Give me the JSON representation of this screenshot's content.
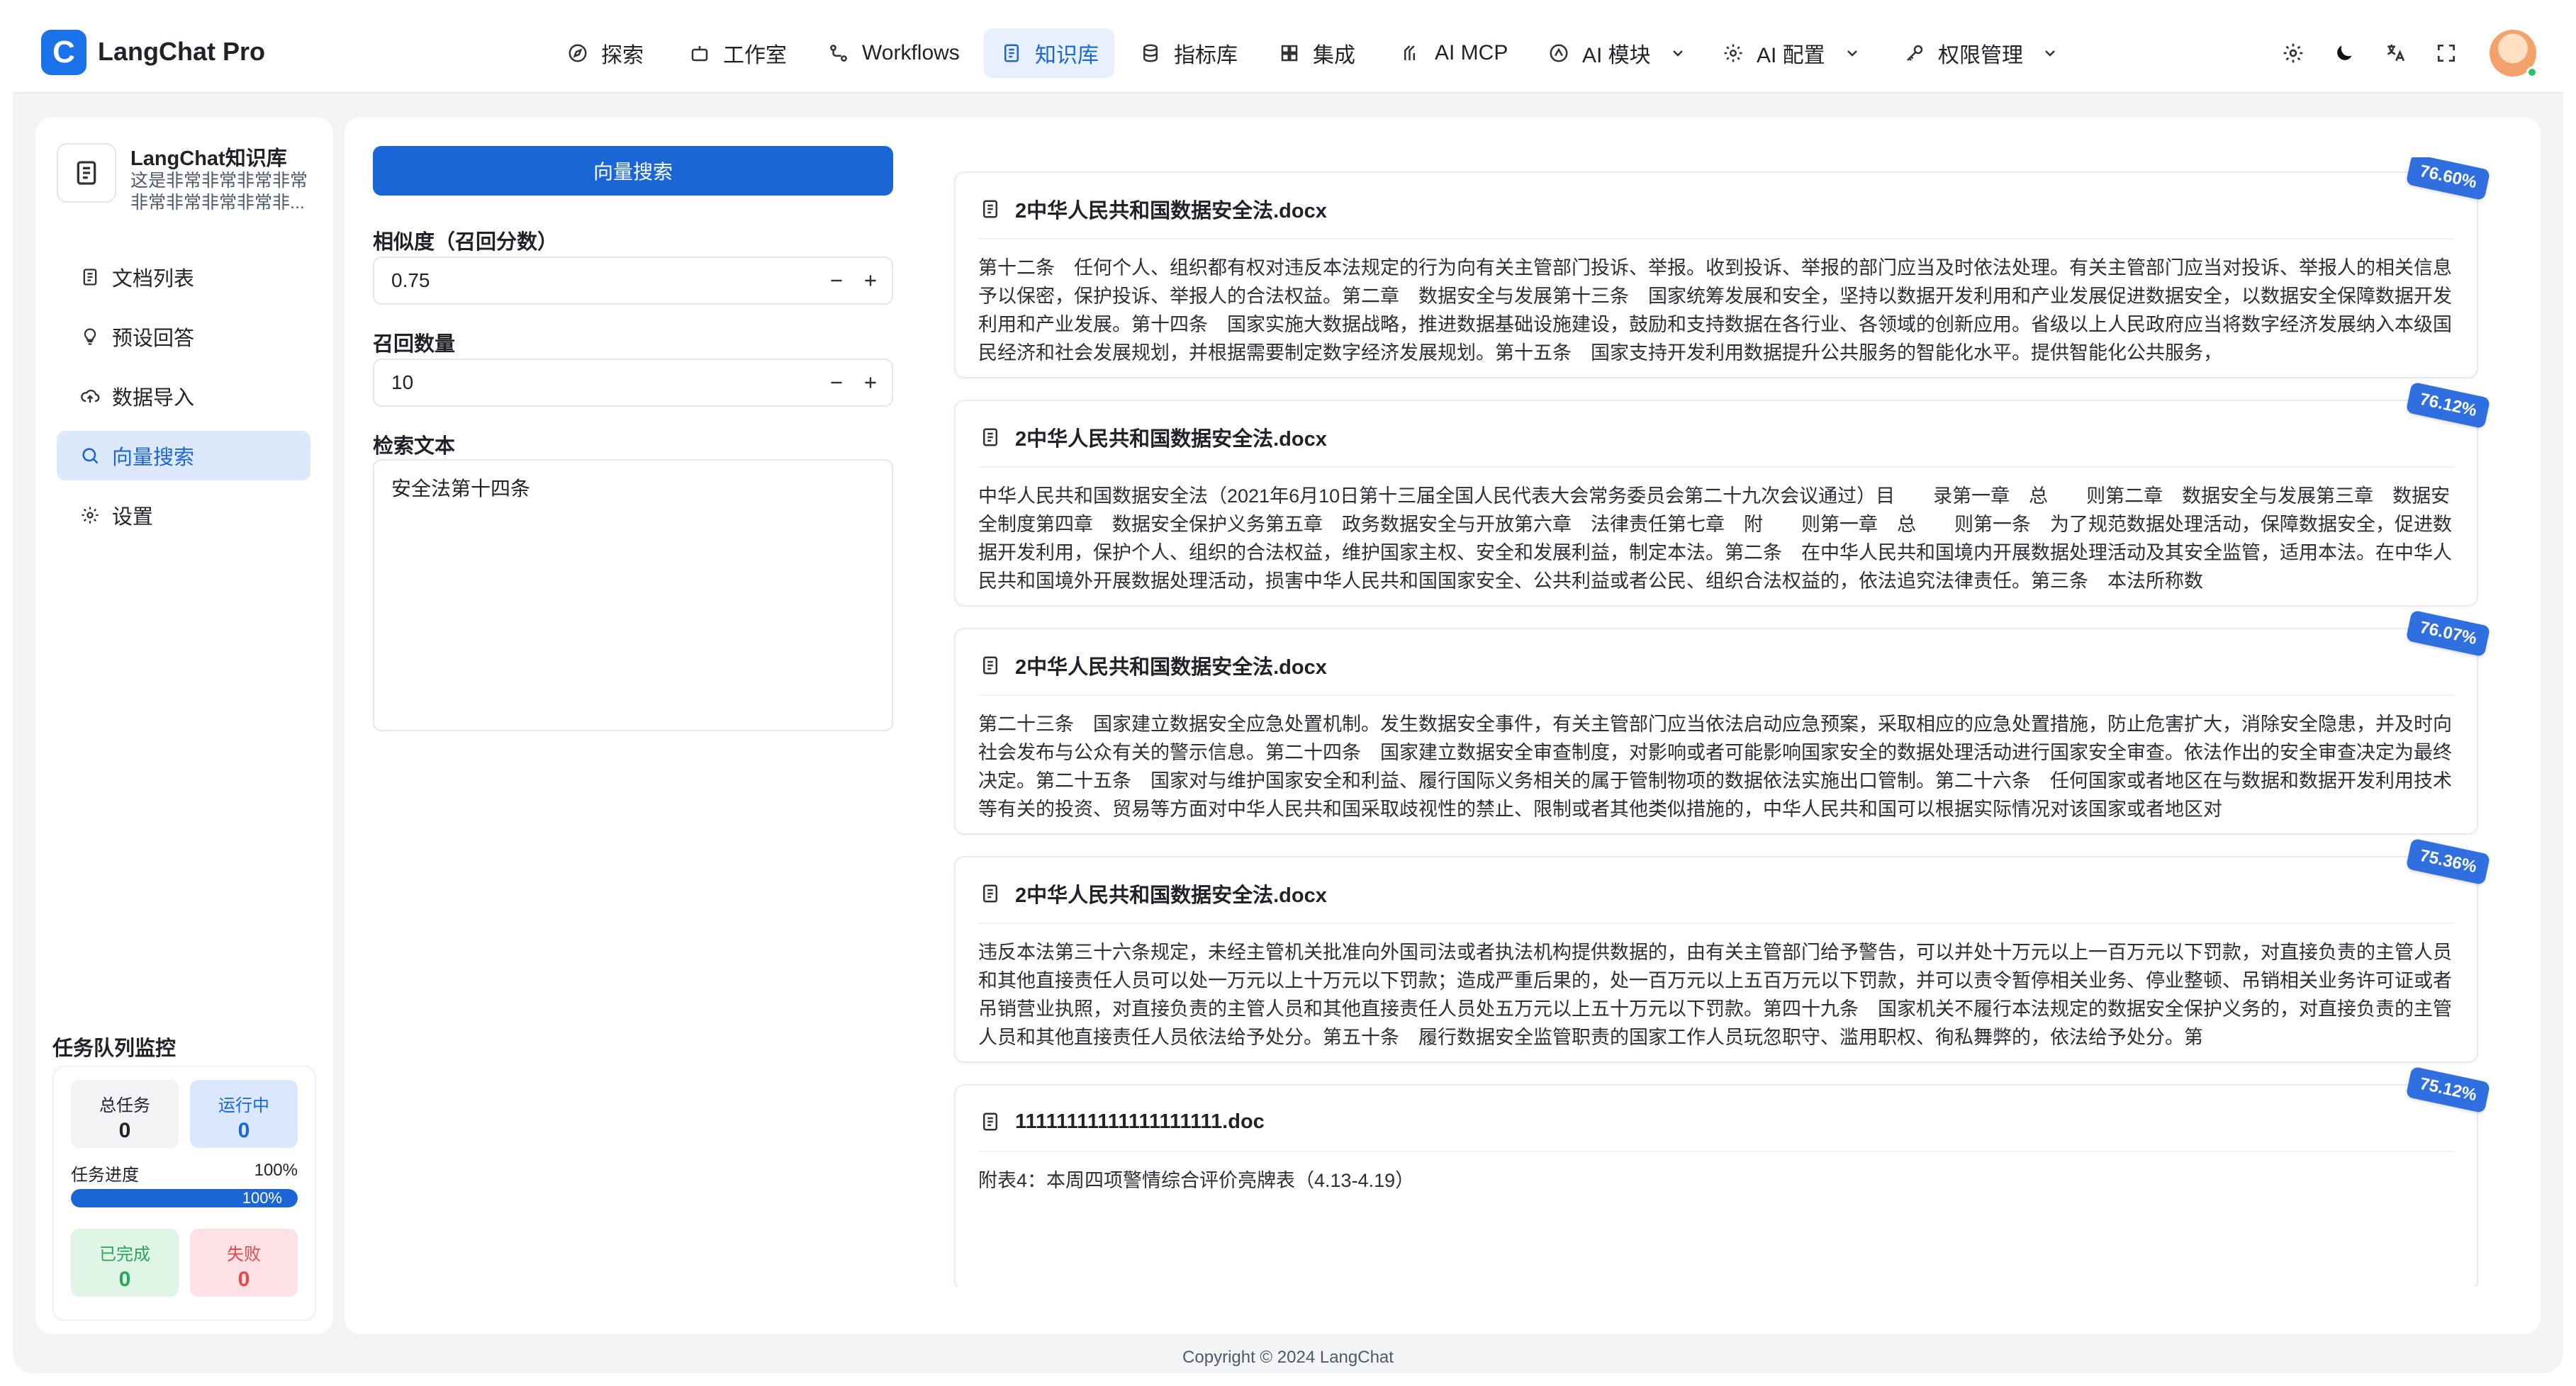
{
  "app": {
    "logo_letter": "C",
    "title": "LangChat Pro"
  },
  "nav": {
    "items": [
      {
        "label": "探索",
        "icon": "compass-icon"
      },
      {
        "label": "工作室",
        "icon": "robot-icon"
      },
      {
        "label": "Workflows",
        "icon": "workflow-icon"
      },
      {
        "label": "知识库",
        "icon": "book-icon",
        "active": true
      },
      {
        "label": "指标库",
        "icon": "database-icon"
      },
      {
        "label": "集成",
        "icon": "grid-icon"
      },
      {
        "label": "AI MCP",
        "icon": "mcp-icon"
      },
      {
        "label": "AI 模块",
        "icon": "module-icon"
      },
      {
        "label": "AI 配置",
        "icon": "gear-icon"
      },
      {
        "label": "权限管理",
        "icon": "key-icon"
      }
    ]
  },
  "toolbar": {
    "icons": [
      "settings-icon",
      "dark-mode-icon",
      "translate-icon",
      "fullscreen-icon"
    ]
  },
  "sidebar": {
    "kb_name": "LangChat知识库",
    "kb_desc": "这是非常非常非常非常非常非常非常非常非...",
    "menu": [
      {
        "label": "文档列表",
        "icon": "document-icon"
      },
      {
        "label": "预设回答",
        "icon": "lightbulb-icon"
      },
      {
        "label": "数据导入",
        "icon": "cloud-upload-icon"
      },
      {
        "label": "向量搜索",
        "icon": "search-icon",
        "active": true
      },
      {
        "label": "设置",
        "icon": "gear-icon"
      }
    ],
    "queue": {
      "title": "任务队列监控",
      "total_label": "总任务",
      "total_value": "0",
      "running_label": "运行中",
      "running_value": "0",
      "progress_label": "任务进度",
      "progress_text": "100%",
      "progress_value": 1.0,
      "done_label": "已完成",
      "done_value": "0",
      "failed_label": "失败",
      "failed_value": "0"
    }
  },
  "search": {
    "button_label": "向量搜索",
    "similarity_label": "相似度（召回分数）",
    "similarity_value": "0.75",
    "count_label": "召回数量",
    "count_value": "10",
    "text_label": "检索文本",
    "text_value": "安全法第十四条"
  },
  "results": [
    {
      "title": "2中华人民共和国数据安全法.docx",
      "score": "76.60%",
      "content": "第十二条　任何个人、组织都有权对违反本法规定的行为向有关主管部门投诉、举报。收到投诉、举报的部门应当及时依法处理。有关主管部门应当对投诉、举报人的相关信息予以保密，保护投诉、举报人的合法权益。第二章　数据安全与发展第十三条　国家统筹发展和安全，坚持以数据开发利用和产业发展促进数据安全，以数据安全保障数据开发利用和产业发展。第十四条　国家实施大数据战略，推进数据基础设施建设，鼓励和支持数据在各行业、各领域的创新应用。省级以上人民政府应当将数字经济发展纳入本级国民经济和社会发展规划，并根据需要制定数字经济发展规划。第十五条　国家支持开发利用数据提升公共服务的智能化水平。提供智能化公共服务，"
    },
    {
      "title": "2中华人民共和国数据安全法.docx",
      "score": "76.12%",
      "content": "中华人民共和国数据安全法（2021年6月10日第十三届全国人民代表大会常务委员会第二十九次会议通过）目　　录第一章　总　　则第二章　数据安全与发展第三章　数据安全制度第四章　数据安全保护义务第五章　政务数据安全与开放第六章　法律责任第七章　附　　则第一章　总　　则第一条　为了规范数据处理活动，保障数据安全，促进数据开发利用，保护个人、组织的合法权益，维护国家主权、安全和发展利益，制定本法。第二条　在中华人民共和国境内开展数据处理活动及其安全监管，适用本法。在中华人民共和国境外开展数据处理活动，损害中华人民共和国国家安全、公共利益或者公民、组织合法权益的，依法追究法律责任。第三条　本法所称数"
    },
    {
      "title": "2中华人民共和国数据安全法.docx",
      "score": "76.07%",
      "content": "第二十三条　国家建立数据安全应急处置机制。发生数据安全事件，有关主管部门应当依法启动应急预案，采取相应的应急处置措施，防止危害扩大，消除安全隐患，并及时向社会发布与公众有关的警示信息。第二十四条　国家建立数据安全审查制度，对影响或者可能影响国家安全的数据处理活动进行国家安全审查。依法作出的安全审查决定为最终决定。第二十五条　国家对与维护国家安全和利益、履行国际义务相关的属于管制物项的数据依法实施出口管制。第二十六条　任何国家或者地区在与数据和数据开发利用技术等有关的投资、贸易等方面对中华人民共和国采取歧视性的禁止、限制或者其他类似措施的，中华人民共和国可以根据实际情况对该国家或者地区对"
    },
    {
      "title": "2中华人民共和国数据安全法.docx",
      "score": "75.36%",
      "content": "违反本法第三十六条规定，未经主管机关批准向外国司法或者执法机构提供数据的，由有关主管部门给予警告，可以并处十万元以上一百万元以下罚款，对直接负责的主管人员和其他直接责任人员可以处一万元以上十万元以下罚款；造成严重后果的，处一百万元以上五百万元以下罚款，并可以责令暂停相关业务、停业整顿、吊销相关业务许可证或者吊销营业执照，对直接负责的主管人员和其他直接责任人员处五万元以上五十万元以下罚款。第四十九条　国家机关不履行本法规定的数据安全保护义务的，对直接负责的主管人员和其他直接责任人员依法给予处分。第五十条　履行数据安全监管职责的国家工作人员玩忽职守、滥用职权、徇私舞弊的，依法给予处分。第"
    },
    {
      "title": "11111111111111111111.doc",
      "score": "75.12%",
      "content": "附表4：本周四项警情综合评价亮牌表（4.13-4.19）"
    }
  ],
  "footer": {
    "copyright": "Copyright © 2024 LangChat"
  },
  "colors": {
    "primary": "#1a66d6",
    "primary_light": "#e8f0fe",
    "badge": "#2f6fe0",
    "success": "#2ba55d",
    "danger": "#e5484d"
  }
}
